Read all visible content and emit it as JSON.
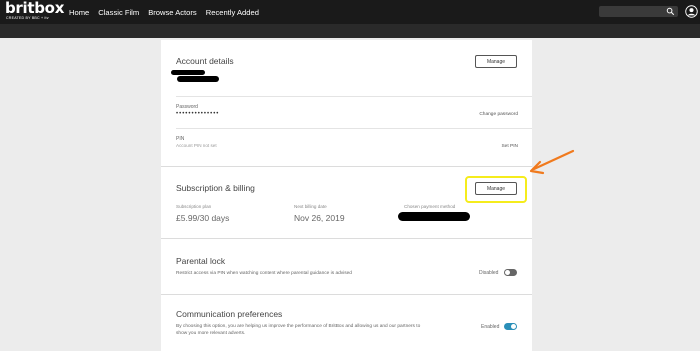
{
  "header": {
    "logo_text": "britbox",
    "logo_sub": "CREATED BY BBC + itv",
    "nav": [
      "Home",
      "Classic Film",
      "Browse Actors",
      "Recently Added"
    ]
  },
  "account": {
    "title": "Account details",
    "manage_label": "Manage",
    "password_label": "Password",
    "password_value": "••••••••••••••",
    "change_password": "Change password",
    "pin_label": "PIN",
    "pin_status": "Account PIN not set",
    "set_pin": "Set PIN"
  },
  "subscription": {
    "title": "Subscription & billing",
    "manage_label": "Manage",
    "plan_label": "Subscription plan",
    "plan_value": "£5.99/30 days",
    "billing_label": "Next billing date",
    "billing_value": "Nov 26, 2019",
    "payment_label": "Chosen payment method"
  },
  "parental": {
    "title": "Parental lock",
    "description": "Restrict access via PIN when watching content where parental guidance is advised",
    "state": "Disabled",
    "enabled_fraction": 0
  },
  "communication": {
    "title": "Communication preferences",
    "description_line1": "By choosing this option, you are helping us improve the performance of BritBox and allowing us and our partners to",
    "description_line2": "show you more relevant adverts.",
    "state": "Enabled",
    "enabled_fraction": 1
  },
  "colors": {
    "topbar": "#1a1a1a",
    "toggle_on": "#2a8fb8",
    "toggle_off": "#666666",
    "highlight": "#f5ec1c",
    "arrow": "#f07a1e"
  }
}
